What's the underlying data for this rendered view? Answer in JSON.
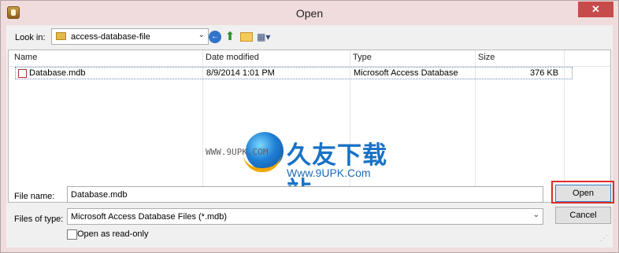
{
  "window": {
    "title": "Open",
    "close": "✕"
  },
  "toolbar": {
    "look_in_label": "Look in:",
    "look_in_value": "access-database-file",
    "back_icon": "back-icon",
    "up_icon": "up-folder-icon",
    "new_folder_icon": "new-folder-icon",
    "views_icon": "views-menu-icon"
  },
  "file_list": {
    "columns": [
      "Name",
      "Date modified",
      "Type",
      "Size"
    ],
    "rows": [
      {
        "name": "Database.mdb",
        "date": "8/9/2014 1:01 PM",
        "type": "Microsoft Access Database",
        "size": "376 KB"
      }
    ]
  },
  "watermark": {
    "left": "WWW.9UPK.COM",
    "chinese": "久友下载站",
    "right": "Www.9UPK.Com"
  },
  "form": {
    "file_name_label": "File name:",
    "file_name_value": "Database.mdb",
    "files_type_label": "Files of type:",
    "files_type_value": "Microsoft Access Database Files (*.mdb)",
    "read_only_label": "Open as read-only"
  },
  "buttons": {
    "open": "Open",
    "cancel": "Cancel"
  },
  "colors": {
    "title_bar": "#f0dcdc",
    "highlight_border": "#df2c2c",
    "watermark_blue": "#1872c6"
  }
}
